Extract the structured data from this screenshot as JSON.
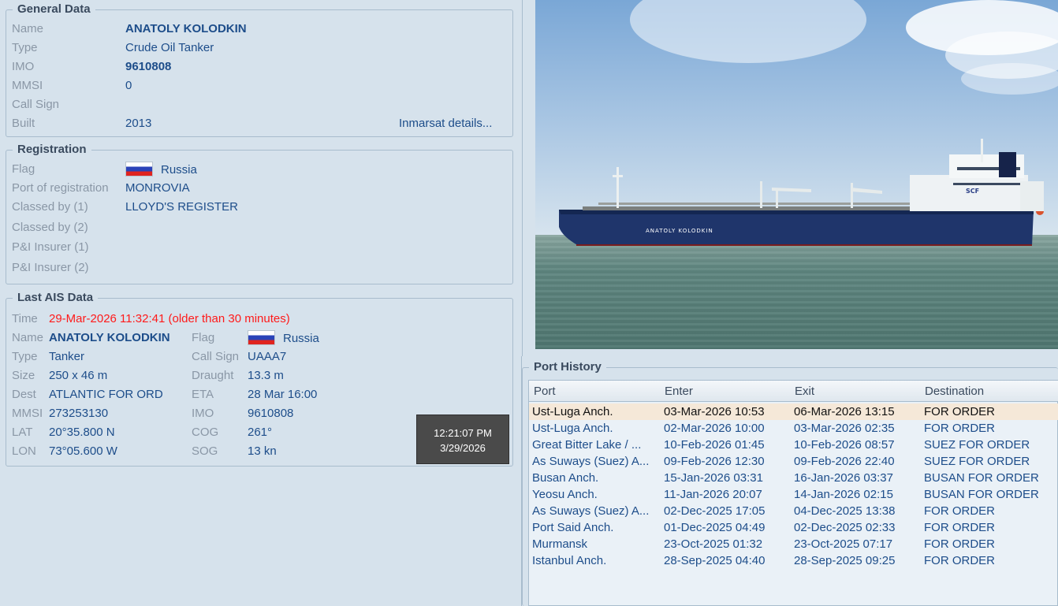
{
  "general": {
    "legend": "General Data",
    "name_label": "Name",
    "name": "ANATOLY KOLODKIN",
    "type_label": "Type",
    "type": "Crude Oil Tanker",
    "imo_label": "IMO",
    "imo": "9610808",
    "mmsi_label": "MMSI",
    "mmsi": "0",
    "callsign_label": "Call Sign",
    "callsign": "",
    "built_label": "Built",
    "built": "2013",
    "inmarsat_link": "Inmarsat details..."
  },
  "registration": {
    "legend": "Registration",
    "flag_label": "Flag",
    "flag": "Russia",
    "port_label": "Port of registration",
    "port": "MONROVIA",
    "classed1_label": "Classed by (1)",
    "classed1": "LLOYD'S REGISTER",
    "classed2_label": "Classed by (2)",
    "pi1_label": "P&I Insurer (1)",
    "pi2_label": "P&I Insurer (2)"
  },
  "ais": {
    "legend": "Last AIS Data",
    "time_label": "Time",
    "time": "29-Mar-2026 11:32:41 (older than 30 minutes)",
    "name_label": "Name",
    "name": "ANATOLY KOLODKIN",
    "flag_label": "Flag",
    "flag": "Russia",
    "type_label": "Type",
    "type": "Tanker",
    "callsign_label": "Call Sign",
    "callsign": "UAAA7",
    "size_label": "Size",
    "size": "250 x 46 m",
    "draught_label": "Draught",
    "draught": "13.3 m",
    "dest_label": "Dest",
    "dest": "ATLANTIC FOR ORD",
    "eta_label": "ETA",
    "eta": "28 Mar 16:00",
    "mmsi_label": "MMSI",
    "mmsi": "273253130",
    "imo_label": "IMO",
    "imo": "9610808",
    "lat_label": "LAT",
    "lat": "20°35.800 N",
    "cog_label": "COG",
    "cog": "261°",
    "lon_label": "LON",
    "lon": "73°05.600 W",
    "sog_label": "SOG",
    "sog": "13 kn"
  },
  "tooltip": {
    "time": "12:21:07 PM",
    "date": "3/29/2026"
  },
  "photo": {
    "hull_text": "ANATOLY KOLODKIN",
    "funnel_text": "SCF"
  },
  "port_history": {
    "legend": "Port History",
    "columns": [
      "Port",
      "Enter",
      "Exit",
      "Destination"
    ],
    "rows": [
      {
        "port": "Ust-Luga Anch.",
        "enter": "03-Mar-2026 10:53",
        "exit": "06-Mar-2026 13:15",
        "dest": "FOR ORDER"
      },
      {
        "port": "Ust-Luga Anch.",
        "enter": "02-Mar-2026 10:00",
        "exit": "03-Mar-2026 02:35",
        "dest": "FOR ORDER"
      },
      {
        "port": "Great Bitter Lake / ...",
        "enter": "10-Feb-2026 01:45",
        "exit": "10-Feb-2026 08:57",
        "dest": "SUEZ FOR ORDER"
      },
      {
        "port": "As Suways (Suez) A...",
        "enter": "09-Feb-2026 12:30",
        "exit": "09-Feb-2026 22:40",
        "dest": "SUEZ FOR ORDER"
      },
      {
        "port": "Busan Anch.",
        "enter": "15-Jan-2026 03:31",
        "exit": "16-Jan-2026 03:37",
        "dest": "BUSAN FOR ORDER"
      },
      {
        "port": "Yeosu Anch.",
        "enter": "11-Jan-2026 20:07",
        "exit": "14-Jan-2026 02:15",
        "dest": "BUSAN FOR ORDER"
      },
      {
        "port": "As Suways (Suez) A...",
        "enter": "02-Dec-2025 17:05",
        "exit": "04-Dec-2025 13:38",
        "dest": "FOR ORDER"
      },
      {
        "port": "Port Said Anch.",
        "enter": "01-Dec-2025 04:49",
        "exit": "02-Dec-2025 02:33",
        "dest": "FOR ORDER"
      },
      {
        "port": "Murmansk",
        "enter": "23-Oct-2025 01:32",
        "exit": "23-Oct-2025 07:17",
        "dest": "FOR ORDER"
      },
      {
        "port": "Istanbul Anch.",
        "enter": "28-Sep-2025 04:40",
        "exit": "28-Sep-2025 09:25",
        "dest": "FOR ORDER"
      }
    ]
  }
}
